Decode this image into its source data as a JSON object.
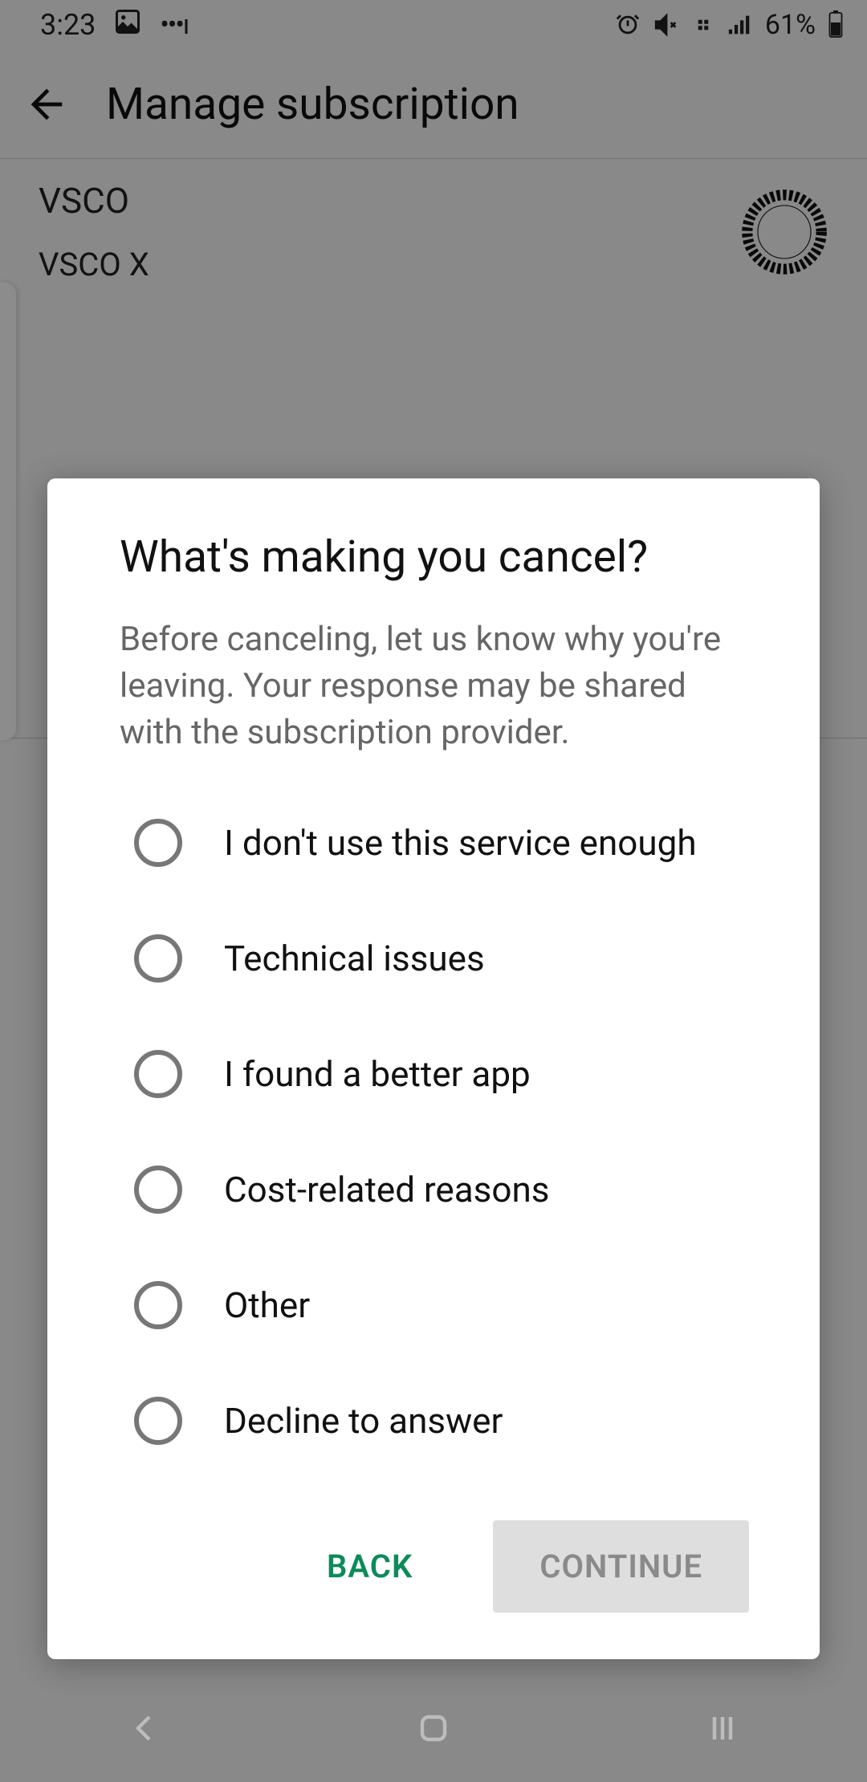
{
  "statusbar": {
    "time": "3:23",
    "battery_text": "61%"
  },
  "appbar": {
    "title": "Manage subscription"
  },
  "subscription": {
    "app_name": "VSCO",
    "plan_name": "VSCO X"
  },
  "dialog": {
    "title": "What's making you cancel?",
    "body": "Before canceling, let us know why you're leaving. Your response may be shared with the subscription provider.",
    "options": [
      {
        "label": "I don't use this service enough"
      },
      {
        "label": "Technical issues"
      },
      {
        "label": "I found a better app"
      },
      {
        "label": "Cost-related reasons"
      },
      {
        "label": "Other"
      },
      {
        "label": "Decline to answer"
      }
    ],
    "back_label": "BACK",
    "continue_label": "CONTINUE",
    "continue_enabled": false
  }
}
